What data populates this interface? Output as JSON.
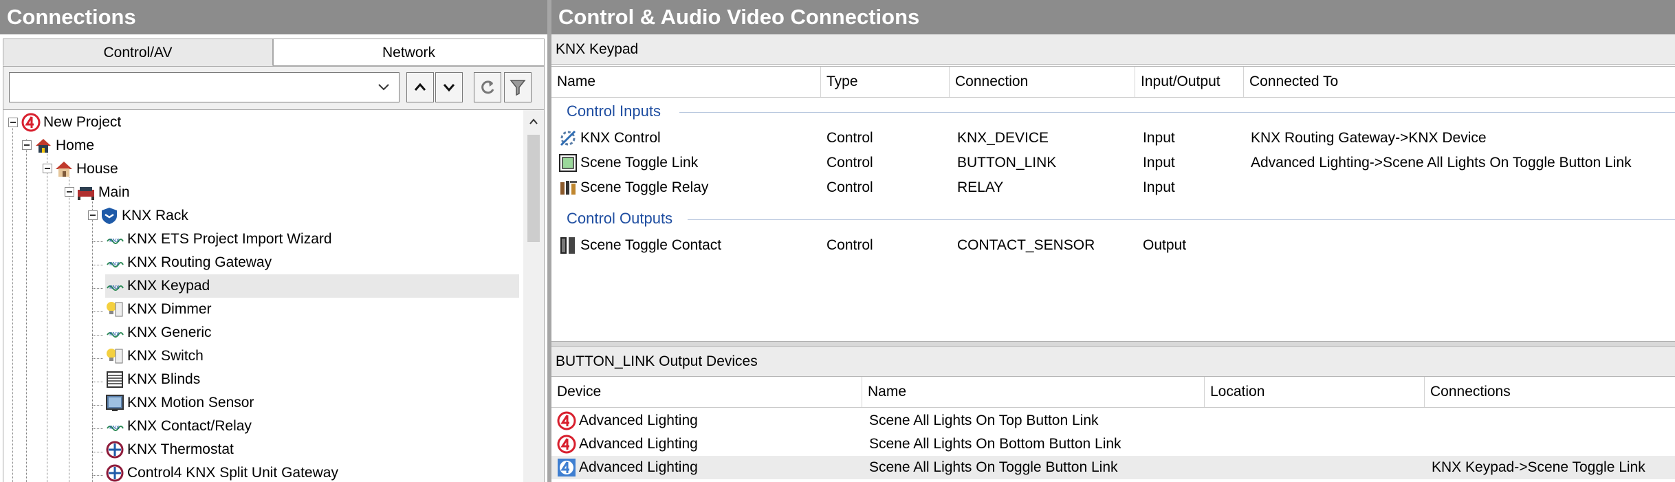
{
  "left": {
    "title": "Connections",
    "tabs": [
      {
        "label": "Control/AV"
      },
      {
        "label": "Network"
      }
    ],
    "filter_value": "",
    "tree": [
      {
        "label": "New Project",
        "icon": "control4-logo-icon"
      },
      {
        "label": "Home",
        "icon": "home-icon"
      },
      {
        "label": "House",
        "icon": "house-icon"
      },
      {
        "label": "Main",
        "icon": "room-icon"
      },
      {
        "label": "KNX Rack",
        "icon": "rack-shield-icon"
      },
      {
        "label": "KNX ETS Project Import Wizard",
        "icon": "knx-icon"
      },
      {
        "label": "KNX Routing Gateway",
        "icon": "knx-icon"
      },
      {
        "label": "KNX Keypad",
        "icon": "knx-icon",
        "selected": true
      },
      {
        "label": "KNX Dimmer",
        "icon": "dimmer-icon"
      },
      {
        "label": "KNX Generic",
        "icon": "knx-icon"
      },
      {
        "label": "KNX Switch",
        "icon": "switch-icon"
      },
      {
        "label": "KNX Blinds",
        "icon": "blinds-icon"
      },
      {
        "label": "KNX Motion Sensor",
        "icon": "motion-sensor-icon"
      },
      {
        "label": "KNX Contact/Relay",
        "icon": "knx-icon"
      },
      {
        "label": "KNX Thermostat",
        "icon": "thermostat-icon"
      },
      {
        "label": "Control4 KNX Split Unit Gateway",
        "icon": "thermostat-icon"
      }
    ]
  },
  "right": {
    "title": "Control & Audio Video Connections",
    "device_name": "KNX Keypad",
    "columns": [
      "Name",
      "Type",
      "Connection",
      "Input/Output",
      "Connected To"
    ],
    "groups": [
      {
        "label": "Control Inputs",
        "rows": [
          {
            "name": "KNX Control",
            "icon": "link-gear-icon",
            "type": "Control",
            "connection": "KNX_DEVICE",
            "io": "Input",
            "connected_to": "KNX Routing Gateway->KNX Device"
          },
          {
            "name": "Scene Toggle Link",
            "icon": "button-link-icon",
            "type": "Control",
            "connection": "BUTTON_LINK",
            "io": "Input",
            "connected_to": "Advanced Lighting->Scene All Lights On Toggle Button Link"
          },
          {
            "name": "Scene Toggle Relay",
            "icon": "relay-icon",
            "type": "Control",
            "connection": "RELAY",
            "io": "Input",
            "connected_to": ""
          }
        ]
      },
      {
        "label": "Control Outputs",
        "rows": [
          {
            "name": "Scene Toggle Contact",
            "icon": "contact-sensor-icon",
            "type": "Control",
            "connection": "CONTACT_SENSOR",
            "io": "Output",
            "connected_to": ""
          }
        ]
      }
    ],
    "output_title": "BUTTON_LINK Output Devices",
    "output_columns": [
      "Device",
      "Name",
      "Location",
      "Connections"
    ],
    "output_rows": [
      {
        "device": "Advanced Lighting",
        "icon": "control4-logo-icon",
        "name": "Scene All Lights On Top Button Link",
        "location": "",
        "connections": ""
      },
      {
        "device": "Advanced Lighting",
        "icon": "control4-logo-icon",
        "name": "Scene All Lights On Bottom Button Link",
        "location": "",
        "connections": ""
      },
      {
        "device": "Advanced Lighting",
        "icon": "control4-logo-blue-icon",
        "name": "Scene All Lights On Toggle Button Link",
        "location": "",
        "connections": "KNX Keypad->Scene Toggle Link",
        "selected": true
      }
    ]
  },
  "colors": {
    "header_bg": "#8c8c8c",
    "group_text": "#1f4ea1",
    "brand_red": "#d8202e",
    "selection_bg": "#e8e8e8"
  }
}
